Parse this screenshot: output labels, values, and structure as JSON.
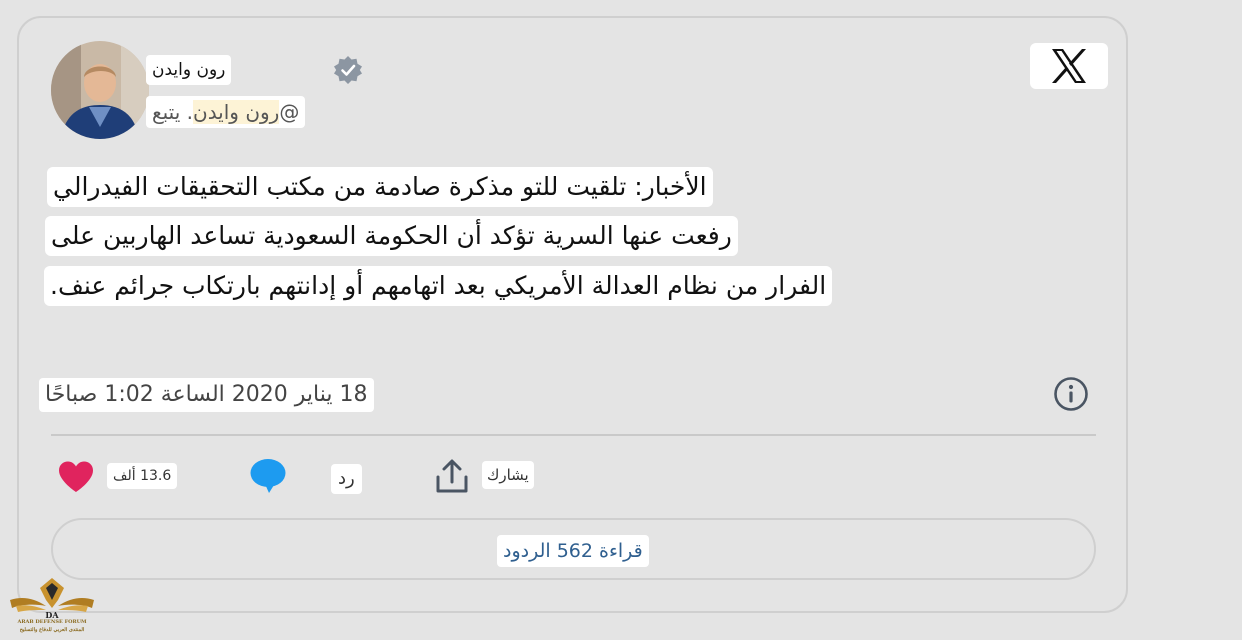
{
  "author": {
    "display_name": "رون وايدن",
    "handle_at": "@",
    "handle_name": "رون وايدن",
    "follow_label": ". يتبع"
  },
  "tweet": {
    "lines": [
      "الأخبار: تلقيت للتو مذكرة صادمة من مكتب التحقيقات الفيدرالي",
      "رفعت عنها السرية تؤكد أن الحكومة السعودية تساعد الهاربين على",
      "الفرار من نظام العدالة الأمريكي بعد اتهامهم أو إدانتهم بارتكاب جرائم عنف."
    ],
    "timestamp": "18 يناير 2020 الساعة 1:02 صباحًا"
  },
  "actions": {
    "like_count": "13.6 ألف",
    "reply_label": "رد",
    "share_label": "يشارك"
  },
  "footer": {
    "read_replies_label": "قراءة 562 الردود"
  },
  "watermark": {
    "line1": "ARAB DEFENSE FORUM",
    "line2": "المنتدى العربي للدفاع والتسليح"
  },
  "icons": {
    "platform": "x-logo-icon",
    "verified": "verified-badge-icon",
    "info": "info-icon",
    "like": "heart-icon",
    "reply": "speech-bubble-icon",
    "share": "share-upload-icon"
  },
  "colors": {
    "like": "#e0245e",
    "reply": "#1d9bf0",
    "verified_badge": "#8c96a2",
    "link_text": "#2f5f8f"
  }
}
